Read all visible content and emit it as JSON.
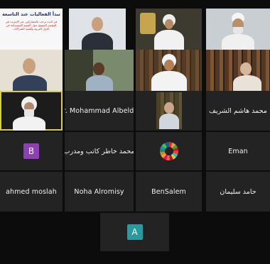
{
  "slide": {
    "title": "تبدأ الفعاليات عند التاسعة",
    "text": "في البدء نرحب بالمشاركين عبر الإنترنت في المؤتمر السنوي حول التنمية المستدامة في الدول العربية وأهمية الشراكات"
  },
  "participants": [
    {
      "name": "Dr. Mohammad Albeld...",
      "avatar_letter": "",
      "avatar_color": ""
    },
    {
      "name": "محمد هاشم الشريف",
      "avatar_letter": "",
      "avatar_color": ""
    },
    {
      "name": "",
      "avatar_letter": "B",
      "avatar_color": "#8e3fb4"
    },
    {
      "name": "محمد خاطر كاتب ومدرب",
      "avatar_letter": "",
      "avatar_color": ""
    },
    {
      "name": "Eman",
      "avatar_letter": "",
      "avatar_color": ""
    },
    {
      "name": "ahmed moslah",
      "avatar_letter": "",
      "avatar_color": ""
    },
    {
      "name": "Noha Alromisy",
      "avatar_letter": "",
      "avatar_color": ""
    },
    {
      "name": "BenSalem",
      "avatar_letter": "",
      "avatar_color": ""
    },
    {
      "name": "حامد سليمان",
      "avatar_letter": "",
      "avatar_color": ""
    },
    {
      "name": "",
      "avatar_letter": "A",
      "avatar_color": "#2a9aa0"
    }
  ],
  "icons": {
    "sdg": "sdg-wheel-icon"
  }
}
